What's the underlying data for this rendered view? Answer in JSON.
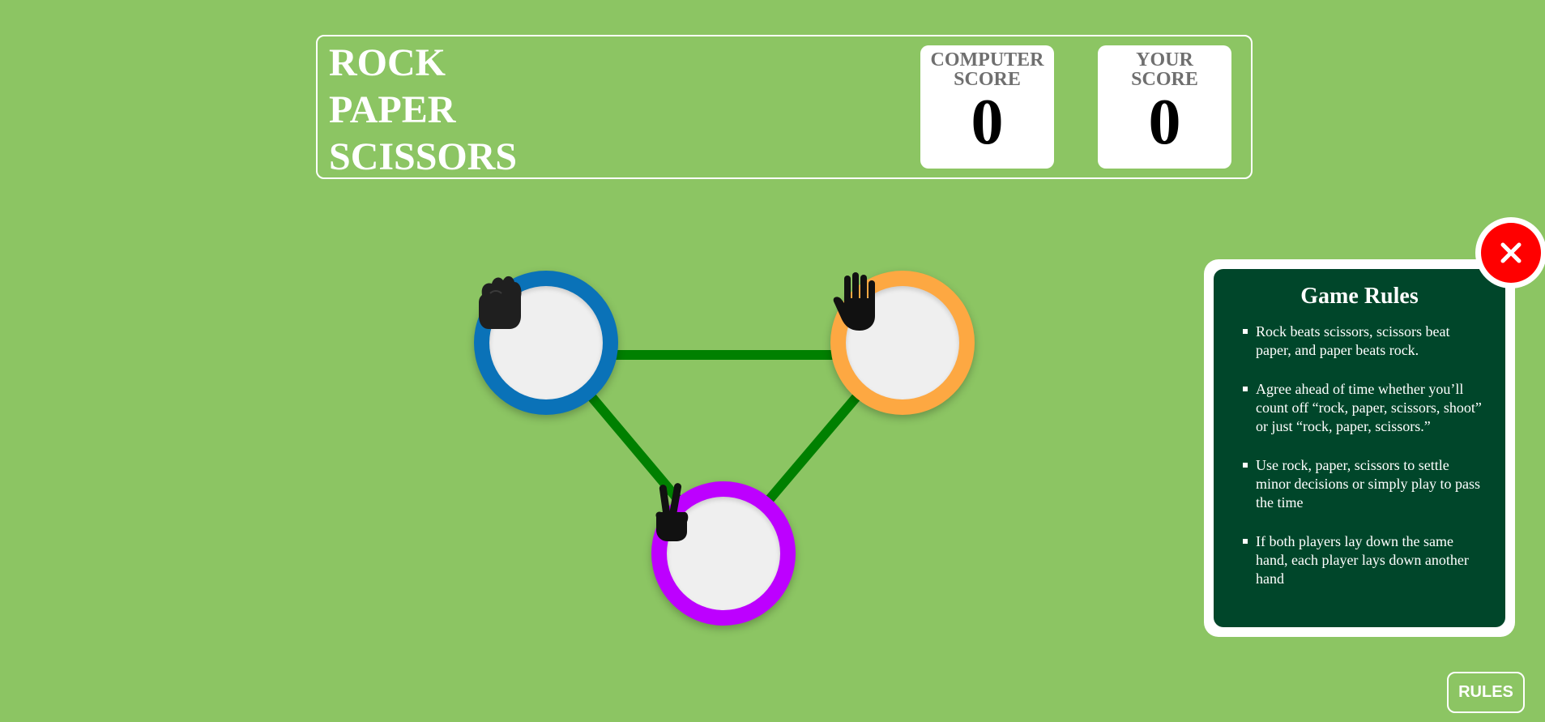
{
  "header": {
    "title_lines": [
      "ROCK",
      "PAPER",
      "SCISSORS"
    ],
    "computer_score_label": "COMPUTER\nSCORE",
    "computer_score": "0",
    "your_score_label": "YOUR\nSCORE",
    "your_score": "0"
  },
  "choices": [
    {
      "name": "rock",
      "color": "#0a72b8",
      "icon": "rock-fist-icon"
    },
    {
      "name": "paper",
      "color": "#fda842",
      "icon": "paper-hand-icon"
    },
    {
      "name": "scissors",
      "color": "#bd00ff",
      "icon": "scissors-peace-icon"
    }
  ],
  "connector_color": "#008000",
  "rules": {
    "title": "Game Rules",
    "items": [
      "Rock beats scissors, scissors beat paper, and paper beats rock.",
      "Agree ahead of time whether you’ll count off “rock, paper, scissors, shoot” or just “rock, paper, scissors.”",
      "Use rock, paper, scissors to settle minor decisions or simply play to pass the time",
      "If both players lay down the same hand, each player lays down another hand"
    ],
    "close_icon": "close-icon"
  },
  "rules_button_label": "RULES",
  "colors": {
    "background": "#8cc563",
    "rules_panel": "#00462a",
    "close": "#ff0000"
  }
}
